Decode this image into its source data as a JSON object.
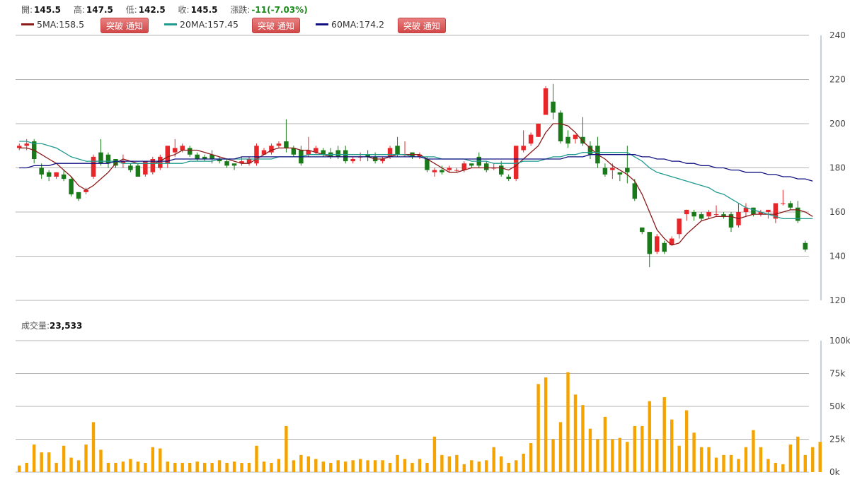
{
  "ohlc": {
    "open_label": "開:",
    "open": "145.5",
    "high_label": "高:",
    "high": "147.5",
    "low_label": "低:",
    "low": "142.5",
    "close_label": "收:",
    "close": "145.5",
    "change_label": "漲跌:",
    "change": "-11(-7.03%)"
  },
  "ma": [
    {
      "text": "5MA:158.5",
      "color": "#8b1a1a",
      "button": "突破 通知"
    },
    {
      "text": "20MA:157.45",
      "color": "#1f9a8f",
      "button": "突破 通知"
    },
    {
      "text": "60MA:174.2",
      "color": "#101080",
      "button": "突破 通知"
    }
  ],
  "volume": {
    "label": "成交量:",
    "value": "23,533"
  },
  "colors": {
    "up": "#e8262a",
    "down": "#1a7a1a",
    "volume": "#f5a300",
    "grid": "#b5b5b5"
  },
  "chart_data": [
    {
      "type": "candlestick",
      "ylim": [
        120,
        240
      ],
      "y_ticks": [
        "240",
        "220",
        "200",
        "180",
        "160",
        "140",
        "120"
      ],
      "candles": [
        [
          189,
          190,
          188,
          191
        ],
        [
          190,
          191,
          188,
          193
        ],
        [
          192,
          184,
          182,
          193
        ],
        [
          180,
          177,
          175,
          182
        ],
        [
          178,
          176,
          174,
          179
        ],
        [
          176,
          178,
          175,
          178
        ],
        [
          177,
          175,
          174,
          179
        ],
        [
          175,
          168,
          167,
          176
        ],
        [
          169,
          166,
          165,
          169
        ],
        [
          169,
          170,
          168,
          171
        ],
        [
          176,
          185,
          175,
          186
        ],
        [
          187,
          182,
          181,
          193
        ],
        [
          186,
          182,
          180,
          187
        ],
        [
          184,
          181,
          180,
          184
        ],
        [
          182,
          183,
          180,
          186
        ],
        [
          181,
          179,
          178,
          182
        ],
        [
          181,
          176,
          176,
          182
        ],
        [
          177,
          183,
          176,
          183
        ],
        [
          178,
          184,
          177,
          185
        ],
        [
          180,
          185,
          179,
          186
        ],
        [
          182,
          190,
          180,
          190
        ],
        [
          187,
          189,
          185,
          193
        ],
        [
          188,
          190,
          187,
          191
        ],
        [
          189,
          186,
          185,
          190
        ],
        [
          186,
          184,
          183,
          187
        ],
        [
          185,
          184,
          183,
          186
        ],
        [
          186,
          184,
          182,
          188
        ],
        [
          184,
          183,
          182,
          185
        ],
        [
          183,
          181,
          180,
          184
        ],
        [
          182,
          181,
          179,
          182
        ],
        [
          182,
          183,
          181,
          185
        ],
        [
          182,
          184,
          181,
          185
        ],
        [
          182,
          190,
          181,
          191
        ],
        [
          186,
          188,
          186,
          189
        ],
        [
          187,
          190,
          186,
          191
        ],
        [
          190,
          191,
          189,
          192
        ],
        [
          192,
          189,
          187,
          202
        ],
        [
          189,
          186,
          185,
          190
        ],
        [
          188,
          182,
          181,
          190
        ],
        [
          186,
          188,
          185,
          194
        ],
        [
          187,
          189,
          186,
          190
        ],
        [
          188,
          186,
          185,
          189
        ],
        [
          187,
          185,
          184,
          189
        ],
        [
          188,
          185,
          184,
          190
        ],
        [
          188,
          183,
          182,
          190
        ],
        [
          183,
          184,
          182,
          185
        ],
        [
          185,
          185,
          183,
          187
        ],
        [
          186,
          185,
          183,
          188
        ],
        [
          185,
          183,
          182,
          187
        ],
        [
          183,
          184,
          182,
          185
        ],
        [
          185,
          189,
          184,
          190
        ],
        [
          190,
          186,
          185,
          194
        ],
        [
          186,
          186,
          185,
          192
        ],
        [
          187,
          185,
          184,
          187
        ],
        [
          185,
          186,
          184,
          187
        ],
        [
          184,
          179,
          178,
          185
        ],
        [
          178,
          179,
          176,
          180
        ],
        [
          179,
          178,
          177,
          181
        ],
        [
          179,
          180,
          178,
          181
        ],
        [
          179,
          179,
          178,
          180
        ],
        [
          179,
          182,
          178,
          183
        ],
        [
          182,
          181,
          180,
          182
        ],
        [
          185,
          181,
          180,
          187
        ],
        [
          182,
          179,
          178,
          183
        ],
        [
          180,
          180,
          179,
          182
        ],
        [
          181,
          177,
          176,
          183
        ],
        [
          176,
          175,
          174,
          177
        ],
        [
          175,
          190,
          174,
          190
        ],
        [
          188,
          190,
          187,
          197
        ],
        [
          191,
          195,
          190,
          196
        ],
        [
          194,
          200,
          194,
          200
        ],
        [
          204,
          216,
          204,
          217
        ],
        [
          210,
          205,
          202,
          218
        ],
        [
          205,
          192,
          191,
          206
        ],
        [
          194,
          191,
          189,
          197
        ],
        [
          193,
          195,
          191,
          195
        ],
        [
          194,
          191,
          190,
          203
        ],
        [
          190,
          186,
          184,
          192
        ],
        [
          190,
          182,
          180,
          194
        ],
        [
          180,
          177,
          176,
          182
        ],
        [
          179,
          180,
          175,
          182
        ],
        [
          178,
          177,
          174,
          178
        ],
        [
          180,
          178,
          173,
          190
        ],
        [
          173,
          166,
          165,
          175
        ],
        [
          153,
          151,
          150,
          153
        ],
        [
          151,
          141,
          135,
          151
        ],
        [
          142,
          149,
          141,
          150
        ],
        [
          146,
          142,
          141,
          147
        ],
        [
          145,
          148,
          145,
          149
        ],
        [
          150,
          157,
          148,
          157
        ],
        [
          159,
          161,
          156,
          161
        ],
        [
          160,
          158,
          156,
          161
        ],
        [
          159,
          157,
          156,
          160
        ],
        [
          158,
          160,
          157,
          161
        ],
        [
          159,
          159,
          158,
          163
        ],
        [
          159,
          158,
          157,
          160
        ],
        [
          159,
          153,
          151,
          160
        ],
        [
          154,
          160,
          153,
          164
        ],
        [
          160,
          162,
          158,
          164
        ],
        [
          162,
          159,
          158,
          162
        ],
        [
          159,
          160,
          158,
          161
        ],
        [
          160,
          161,
          157,
          161
        ],
        [
          157,
          164,
          155,
          164
        ],
        [
          164,
          164,
          163,
          170
        ],
        [
          164,
          162,
          161,
          165
        ],
        [
          162,
          156,
          155,
          165
        ],
        [
          146,
          143,
          142,
          147
        ]
      ],
      "series": [
        {
          "name": "5MA",
          "values": [
            189,
            189,
            188,
            186,
            184,
            182,
            179,
            176,
            172,
            170,
            172,
            175,
            178,
            182,
            184,
            183,
            182,
            182,
            182,
            183,
            185,
            186,
            188,
            188,
            188,
            187,
            186,
            185,
            184,
            183,
            182,
            182,
            184,
            186,
            188,
            189,
            189,
            189,
            188,
            188,
            187,
            186,
            185,
            185,
            185,
            185,
            185,
            185,
            184,
            184,
            185,
            186,
            186,
            186,
            186,
            184,
            182,
            180,
            178,
            178,
            179,
            180,
            180,
            180,
            180,
            180,
            179,
            181,
            184,
            187,
            190,
            196,
            200,
            200,
            199,
            196,
            192,
            189,
            186,
            184,
            181,
            179,
            177,
            174,
            168,
            160,
            152,
            148,
            145,
            146,
            150,
            153,
            156,
            157,
            158,
            158,
            158,
            157,
            158,
            159,
            159,
            159,
            159,
            160,
            161,
            161,
            160,
            158
          ]
        },
        {
          "name": "20MA",
          "values": [
            192,
            192,
            191,
            191,
            190,
            189,
            187,
            185,
            184,
            183,
            183,
            183,
            183,
            183,
            182,
            182,
            182,
            182,
            182,
            182,
            182,
            182,
            182,
            183,
            183,
            183,
            183,
            184,
            184,
            184,
            184,
            184,
            184,
            184,
            184,
            185,
            185,
            185,
            185,
            186,
            186,
            186,
            186,
            186,
            186,
            186,
            186,
            186,
            186,
            186,
            186,
            186,
            186,
            185,
            185,
            185,
            185,
            184,
            184,
            184,
            184,
            183,
            183,
            183,
            182,
            182,
            182,
            182,
            183,
            183,
            183,
            184,
            185,
            185,
            186,
            186,
            187,
            187,
            187,
            187,
            187,
            187,
            187,
            185,
            183,
            180,
            178,
            177,
            176,
            175,
            174,
            173,
            172,
            171,
            169,
            168,
            166,
            164,
            162,
            161,
            160,
            159,
            158,
            157,
            157,
            157,
            157,
            157
          ]
        },
        {
          "name": "60MA",
          "values": [
            180,
            180,
            181,
            181,
            181,
            182,
            182,
            182,
            182,
            182,
            182,
            182,
            182,
            183,
            183,
            183,
            183,
            183,
            183,
            183,
            183,
            184,
            184,
            184,
            184,
            184,
            184,
            184,
            184,
            184,
            185,
            185,
            185,
            185,
            185,
            185,
            185,
            185,
            185,
            185,
            185,
            185,
            185,
            185,
            185,
            185,
            185,
            185,
            185,
            185,
            185,
            185,
            185,
            185,
            185,
            184,
            184,
            184,
            184,
            184,
            184,
            184,
            184,
            184,
            184,
            184,
            184,
            184,
            184,
            184,
            184,
            184,
            184,
            184,
            185,
            185,
            185,
            186,
            186,
            186,
            186,
            186,
            186,
            186,
            185,
            185,
            184,
            184,
            183,
            183,
            182,
            182,
            181,
            181,
            180,
            180,
            179,
            179,
            178,
            178,
            178,
            177,
            177,
            176,
            176,
            175,
            175,
            174
          ]
        }
      ]
    },
    {
      "type": "bar",
      "name": "成交量",
      "ylim": [
        0,
        100000
      ],
      "y_ticks": [
        "100k",
        "75k",
        "50k",
        "25k",
        "0k"
      ],
      "values": [
        5000,
        7000,
        21000,
        15000,
        15000,
        7000,
        20000,
        11000,
        9000,
        21000,
        38000,
        17000,
        7000,
        7000,
        8000,
        10000,
        8000,
        7000,
        19000,
        18000,
        8000,
        7000,
        7000,
        7000,
        8000,
        7000,
        7000,
        9000,
        7000,
        8000,
        7000,
        7000,
        20000,
        8000,
        7000,
        10000,
        35000,
        9000,
        13000,
        12000,
        10000,
        8000,
        7000,
        9000,
        8000,
        9000,
        10000,
        9000,
        9000,
        9000,
        7000,
        13000,
        10000,
        7000,
        10000,
        7000,
        27000,
        13000,
        12000,
        13000,
        6000,
        9000,
        8000,
        9000,
        19000,
        12000,
        7000,
        9000,
        14000,
        22000,
        67000,
        72000,
        25000,
        38000,
        76000,
        59000,
        51000,
        33000,
        25000,
        42000,
        25000,
        26000,
        23000,
        35000,
        35000,
        54000,
        25000,
        57000,
        40000,
        20000,
        47000,
        30000,
        19000,
        19000,
        11000,
        13000,
        13000,
        10000,
        19000,
        32000,
        19000,
        10000,
        7000,
        6000,
        21000,
        27000,
        13000,
        19000,
        23000
      ]
    }
  ]
}
